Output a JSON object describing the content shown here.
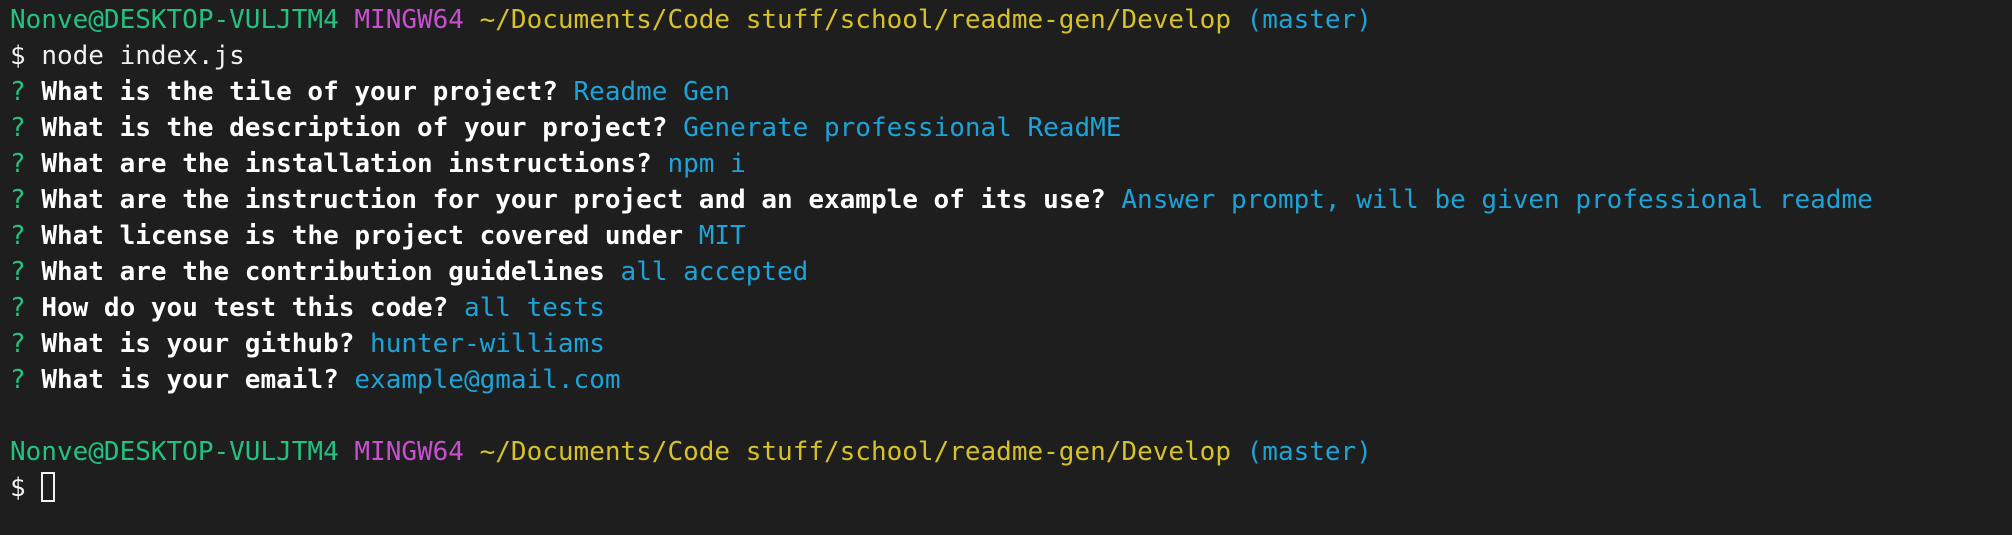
{
  "header1": {
    "user": "Nonve@DESKTOP-VULJTM4",
    "system": "MINGW64",
    "path": "~/Documents/Code stuff/school/readme-gen/Develop",
    "branch": "(master)"
  },
  "command": {
    "prompt": "$",
    "text": "node index.js"
  },
  "qa": [
    {
      "mark": "?",
      "question": "What is the tile of your project?",
      "answer": "Readme Gen"
    },
    {
      "mark": "?",
      "question": "What is the description of your project?",
      "answer": "Generate professional ReadME"
    },
    {
      "mark": "?",
      "question": "What are the installation instructions?",
      "answer": "npm i"
    },
    {
      "mark": "?",
      "question": "What are the instruction for your project and an example of its use?",
      "answer": "Answer prompt, will be given professional readme"
    },
    {
      "mark": "?",
      "question": "What license is the project covered under",
      "answer": "MIT"
    },
    {
      "mark": "?",
      "question": "What are the contribution guidelines",
      "answer": "all accepted"
    },
    {
      "mark": "?",
      "question": "How do you test this code?",
      "answer": "all tests"
    },
    {
      "mark": "?",
      "question": "What is your github?",
      "answer": "hunter-williams"
    },
    {
      "mark": "?",
      "question": "What is your email?",
      "answer": "example@gmail.com"
    }
  ],
  "header2": {
    "user": "Nonve@DESKTOP-VULJTM4",
    "system": "MINGW64",
    "path": "~/Documents/Code stuff/school/readme-gen/Develop",
    "branch": "(master)"
  },
  "final_prompt": {
    "prompt": "$"
  },
  "colors": {
    "background": "#1e1e1e",
    "user": "#23c27e",
    "system": "#c84fcf",
    "path": "#d6c12a",
    "branch": "#1da3d8",
    "answer": "#1da3d8"
  }
}
